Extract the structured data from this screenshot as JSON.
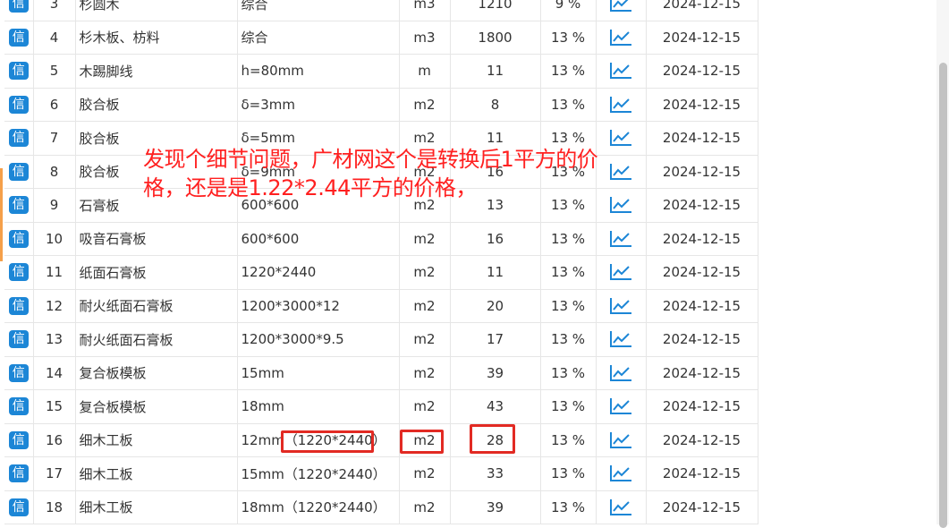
{
  "table": {
    "badge_label": "信",
    "rows": [
      {
        "index": "3",
        "name": "杉圆木",
        "spec": "综合",
        "unit": "m3",
        "price": "1210",
        "tax": "9 %",
        "date": "2024-12-15"
      },
      {
        "index": "4",
        "name": "杉木板、枋料",
        "spec": "综合",
        "unit": "m3",
        "price": "1800",
        "tax": "13 %",
        "date": "2024-12-15"
      },
      {
        "index": "5",
        "name": "木踢脚线",
        "spec": "h=80mm",
        "unit": "m",
        "price": "11",
        "tax": "13 %",
        "date": "2024-12-15"
      },
      {
        "index": "6",
        "name": "胶合板",
        "spec": "δ=3mm",
        "unit": "m2",
        "price": "8",
        "tax": "13 %",
        "date": "2024-12-15"
      },
      {
        "index": "7",
        "name": "胶合板",
        "spec": "δ=5mm",
        "unit": "m2",
        "price": "11",
        "tax": "13 %",
        "date": "2024-12-15"
      },
      {
        "index": "8",
        "name": "胶合板",
        "spec": "δ=9mm",
        "unit": "m2",
        "price": "16",
        "tax": "13 %",
        "date": "2024-12-15"
      },
      {
        "index": "9",
        "name": "石膏板",
        "spec": "600*600",
        "unit": "m2",
        "price": "13",
        "tax": "13 %",
        "date": "2024-12-15"
      },
      {
        "index": "10",
        "name": "吸音石膏板",
        "spec": "600*600",
        "unit": "m2",
        "price": "16",
        "tax": "13 %",
        "date": "2024-12-15"
      },
      {
        "index": "11",
        "name": "纸面石膏板",
        "spec": "1220*2440",
        "unit": "m2",
        "price": "11",
        "tax": "13 %",
        "date": "2024-12-15"
      },
      {
        "index": "12",
        "name": "耐火纸面石膏板",
        "spec": "1200*3000*12",
        "unit": "m2",
        "price": "20",
        "tax": "13 %",
        "date": "2024-12-15"
      },
      {
        "index": "13",
        "name": "耐火纸面石膏板",
        "spec": "1200*3000*9.5",
        "unit": "m2",
        "price": "17",
        "tax": "13 %",
        "date": "2024-12-15"
      },
      {
        "index": "14",
        "name": "复合板模板",
        "spec": "15mm",
        "unit": "m2",
        "price": "39",
        "tax": "13 %",
        "date": "2024-12-15"
      },
      {
        "index": "15",
        "name": "复合板模板",
        "spec": "18mm",
        "unit": "m2",
        "price": "43",
        "tax": "13 %",
        "date": "2024-12-15"
      },
      {
        "index": "16",
        "name": "细木工板",
        "spec": "12mm（1220*2440）",
        "unit": "m2",
        "price": "28",
        "tax": "13 %",
        "date": "2024-12-15"
      },
      {
        "index": "17",
        "name": "细木工板",
        "spec": "15mm（1220*2440）",
        "unit": "m2",
        "price": "33",
        "tax": "13 %",
        "date": "2024-12-15"
      },
      {
        "index": "18",
        "name": "细木工板",
        "spec": "18mm（1220*2440）",
        "unit": "m2",
        "price": "39",
        "tax": "13 %",
        "date": "2024-12-15"
      }
    ]
  },
  "annotation": {
    "line1": "发现个细节问题，广材网这个是转换后1平方的价",
    "line2": "格，还是是1.22*2.44平方的价格，"
  },
  "colors": {
    "badge": "#1c86d6",
    "trend_icon": "#1c86d6",
    "annotation_text": "#ff2020",
    "highlight_box": "#e22a23",
    "grid_line": "#e6e6e6"
  },
  "icons": {
    "badge": "xin-badge",
    "trend": "trend-chart-icon"
  }
}
